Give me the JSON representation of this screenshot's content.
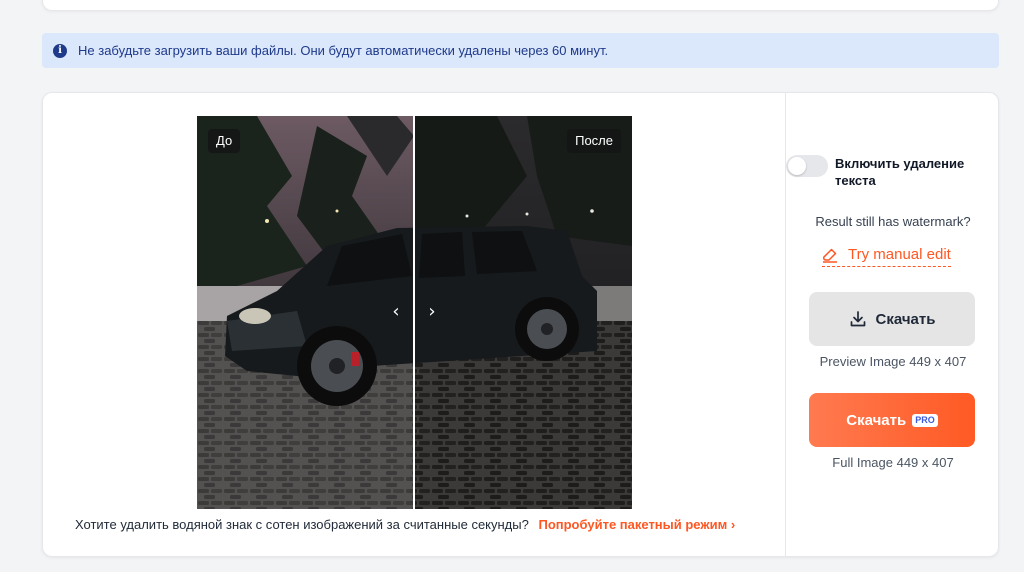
{
  "notice": {
    "icon": "info-icon",
    "text": "Не забудьте загрузить ваши файлы. Они будут автоматически удалены через 60 минут."
  },
  "compare": {
    "before_label": "До",
    "after_label": "После",
    "image_subject": "dark SUV parked on snowy paving stones at night"
  },
  "batch": {
    "question": "Хотите удалить водяной знак с сотен изображений за считанные секунды?",
    "link": "Попробуйте пакетный режим",
    "link_icon": "chevron-right-icon"
  },
  "sidebar": {
    "toggle_label": "Включить удаление текста",
    "toggle_on": false,
    "watermark_question": "Result still has watermark?",
    "manual_edit": "Try manual edit",
    "download_label": "Скачать",
    "preview_info": "Preview Image 449 x 407",
    "pro_download_label": "Скачать",
    "pro_badge": "PRO",
    "full_info": "Full Image 449 x 407"
  },
  "colors": {
    "accent": "#ff5722",
    "notice_bg": "#dbe7fb",
    "notice_text": "#1e3a8a",
    "pro_badge_text": "#3b5bdb"
  }
}
